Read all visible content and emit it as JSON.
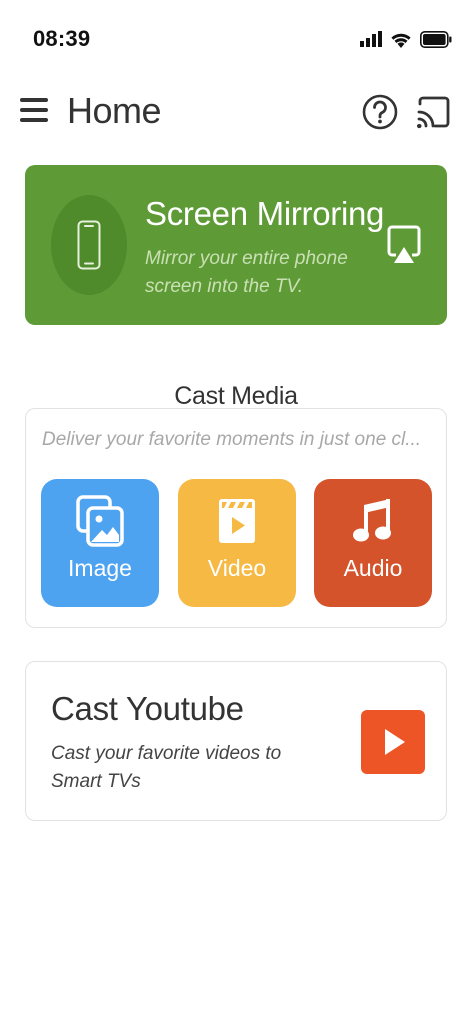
{
  "status_bar": {
    "time": "08:39"
  },
  "header": {
    "title": "Home",
    "menu_icon": "hamburger-menu-icon",
    "help_icon": "help-circle-icon",
    "cast_icon": "cast-icon"
  },
  "screen_mirroring": {
    "title": "Screen Mirroring",
    "subtitle": "Mirror your entire phone screen into the TV.",
    "color": "#5e9b36"
  },
  "cast_media": {
    "title": "Cast Media",
    "subtitle": "Deliver your favorite moments in just one cl...",
    "buttons": [
      {
        "label": "Image",
        "icon": "image-gallery-icon",
        "color": "#4ea3f0"
      },
      {
        "label": "Video",
        "icon": "video-clapper-icon",
        "color": "#f5b944"
      },
      {
        "label": "Audio",
        "icon": "music-note-icon",
        "color": "#d4532b"
      }
    ]
  },
  "cast_youtube": {
    "title": "Cast Youtube",
    "subtitle": "Cast your favorite videos to Smart TVs",
    "icon": "youtube-play-icon",
    "color": "#ee5526"
  }
}
